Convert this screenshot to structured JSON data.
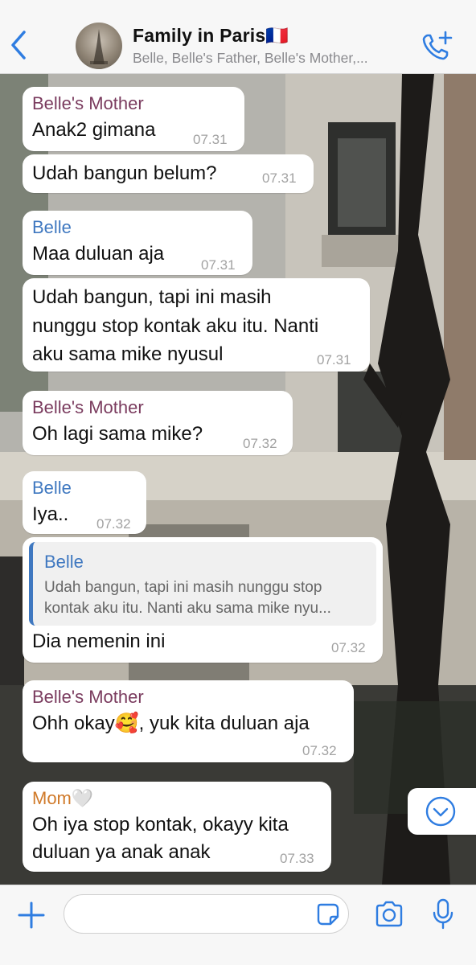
{
  "header": {
    "back_icon": "chevron-left-icon",
    "group_name": "Family in Paris🇫🇷",
    "participants": "Belle, Belle's Father, Belle's Mother,...",
    "call_icon": "add-call-icon",
    "accent": "#2f7de1"
  },
  "messages": [
    {
      "sender": "Belle's Mother",
      "text": "Anak2 gimana",
      "time": "07.31"
    },
    {
      "text": "Udah bangun belum?",
      "time": "07.31"
    },
    {
      "sender": "Belle",
      "text": "Maa duluan aja",
      "time": "07.31"
    },
    {
      "lines": [
        "Udah bangun, tapi ini masih",
        "nunggu stop kontak aku itu. Nanti",
        "aku sama mike nyusul"
      ],
      "time": "07.31"
    },
    {
      "sender": "Belle's Mother",
      "text": "Oh lagi sama mike?",
      "time": "07.32"
    },
    {
      "sender": "Belle",
      "text": "Iya..",
      "time": "07.32"
    },
    {
      "quote_sender": "Belle",
      "quote_lines": [
        "Udah bangun, tapi ini masih nunggu stop",
        "kontak aku itu. Nanti aku sama mike nyu..."
      ],
      "text": "Dia nemenin ini",
      "time": "07.32"
    },
    {
      "sender": "Belle's Mother",
      "text": "Ohh okay🥰, yuk kita duluan aja",
      "time": "07.32"
    },
    {
      "sender": "Mom🤍",
      "lines": [
        "Oh iya stop kontak, okayy kita",
        "duluan ya anak anak"
      ],
      "time": "07.33"
    }
  ],
  "scroll_icon": "chevron-down-circle-icon",
  "input_bar": {
    "plus_icon": "plus-icon",
    "input_placeholder": "",
    "sticker_icon": "sticker-icon",
    "camera_icon": "camera-icon",
    "mic_icon": "microphone-icon"
  },
  "colors": {
    "sender_mother": "#7a3b5e",
    "sender_belle": "#3f78c0",
    "sender_mom": "#d07a2a"
  }
}
